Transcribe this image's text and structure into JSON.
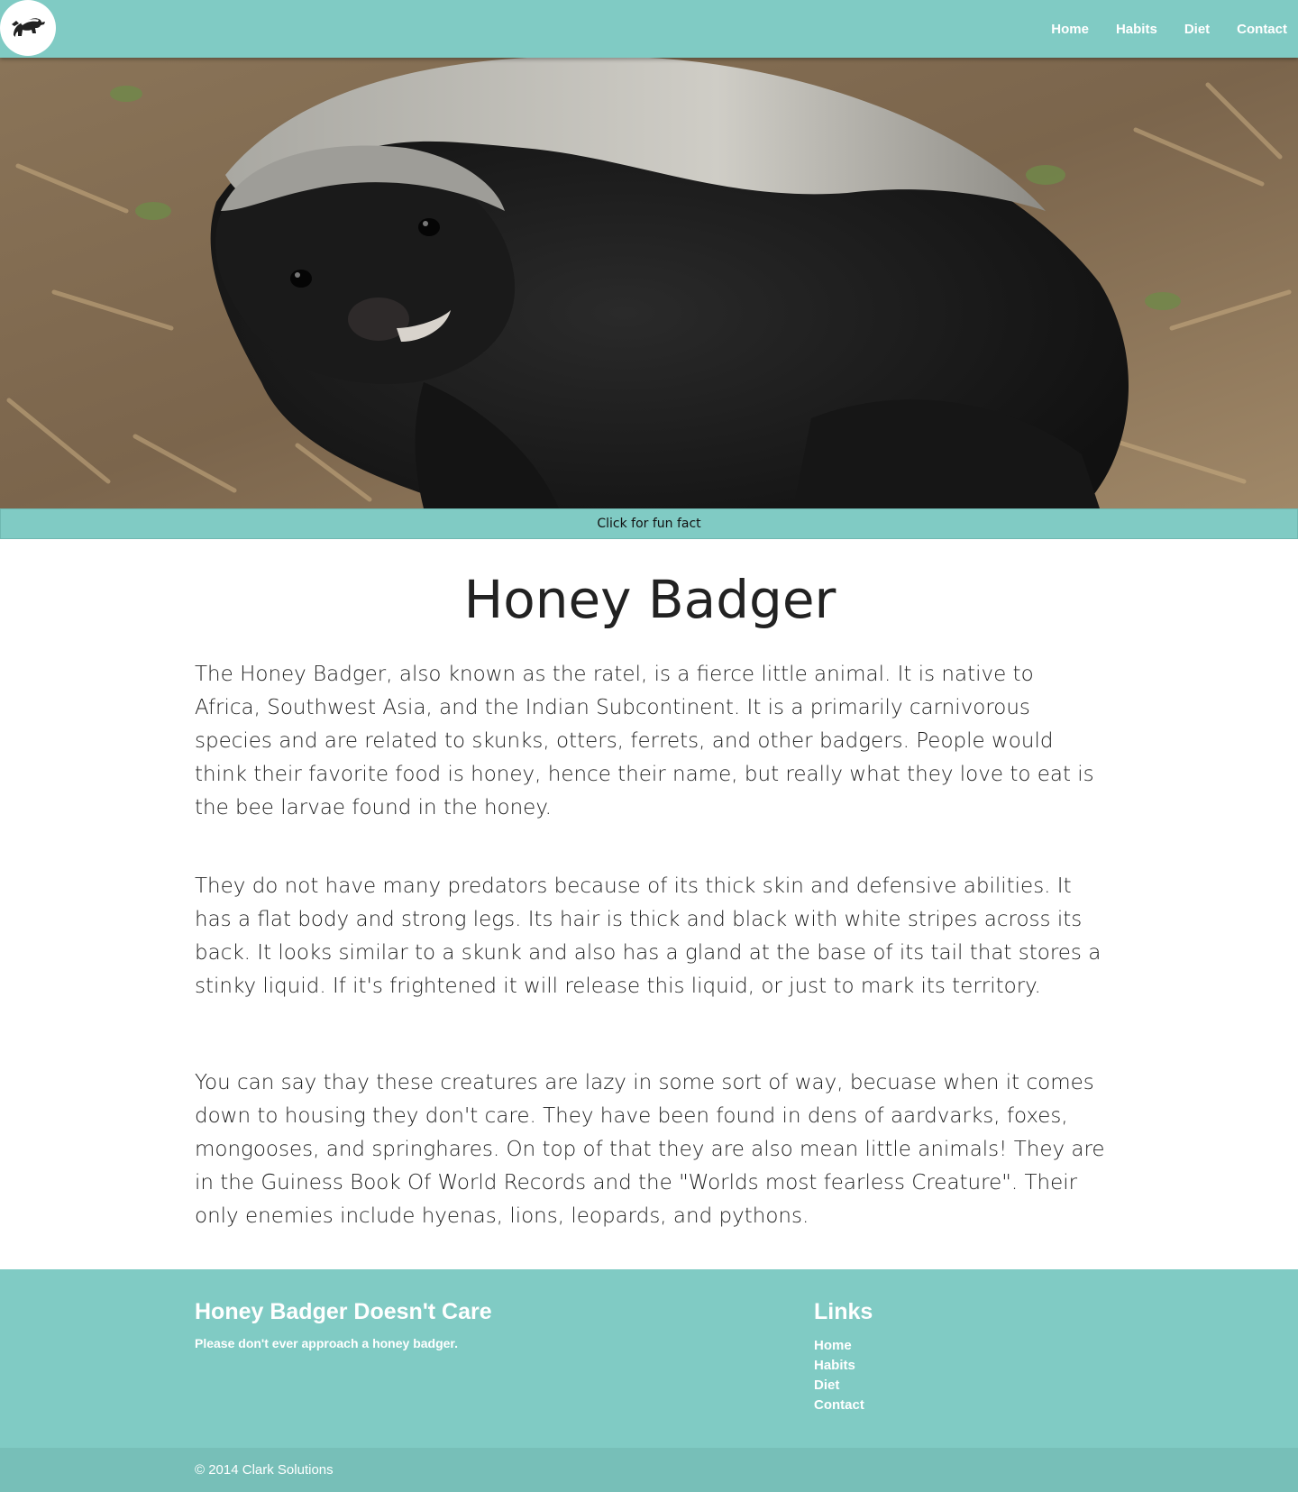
{
  "nav": {
    "logo_icon": "honey-badger-logo",
    "links": [
      "Home",
      "Habits",
      "Diet",
      "Contact"
    ]
  },
  "hero": {
    "funfact_label": "Click for fun fact"
  },
  "main": {
    "title": "Honey Badger",
    "paragraphs": [
      "The Honey Badger, also known as the ratel, is a fierce little animal. It is native to Africa, Southwest Asia, and the Indian Subcontinent. It is a primarily carnivorous species and are related to skunks, otters, ferrets, and other badgers. People would think their favorite food is honey, hence their name, but really what they love to eat is the bee larvae found in the honey.",
      "They do not have many predators because of its thick skin and defensive abilities. It has a flat body and strong legs. Its hair is thick and black with white stripes across its back. It looks similar to a skunk and also has a gland at the base of its tail that stores a stinky liquid. If it's frightened it will release this liquid, or just to mark its territory.",
      "You can say thay these creatures are lazy in some sort of way, becuase when it comes down to housing they don't care. They have been found in dens of aardvarks, foxes, mongooses, and springhares. On top of that they are also mean little animals! They are in the Guiness Book Of World Records and the \"Worlds most fearless Creature\". Their only enemies include hyenas, lions, leopards, and pythons."
    ]
  },
  "footer": {
    "title": "Honey Badger Doesn't Care",
    "tagline": "Please don't ever approach a honey badger.",
    "links_title": "Links",
    "links": [
      "Home",
      "Habits",
      "Diet",
      "Contact"
    ],
    "copyright": "© 2014 Clark Solutions"
  },
  "colors": {
    "accent": "#80cbc4",
    "accent_dark": "#77bfb8",
    "text": "#222222"
  }
}
